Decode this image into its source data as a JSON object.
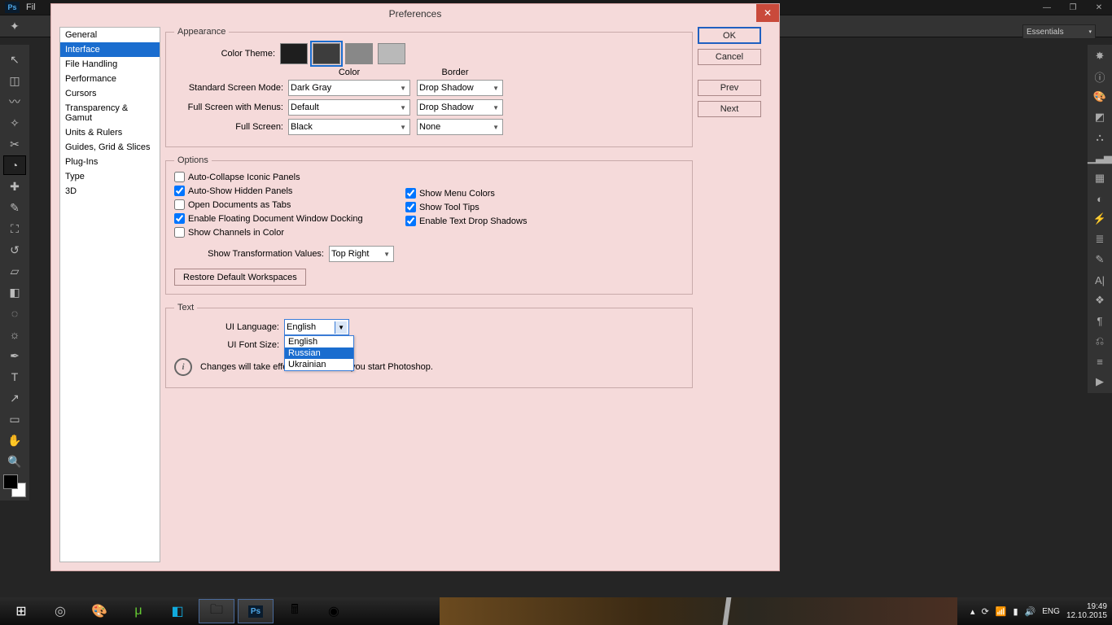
{
  "app": {
    "logo": "Ps",
    "menu_fragment": "Fil"
  },
  "window_controls": {
    "minimize": "—",
    "maximize": "❐",
    "close": "✕"
  },
  "optionbar": {
    "workspace": "Essentials"
  },
  "dialog": {
    "title": "Preferences",
    "buttons": {
      "ok": "OK",
      "cancel": "Cancel",
      "prev": "Prev",
      "next": "Next"
    },
    "nav": [
      "General",
      "Interface",
      "File Handling",
      "Performance",
      "Cursors",
      "Transparency & Gamut",
      "Units & Rulers",
      "Guides, Grid & Slices",
      "Plug-Ins",
      "Type",
      "3D"
    ],
    "nav_selected": 1,
    "appearance": {
      "legend": "Appearance",
      "color_theme_label": "Color Theme:",
      "swatches": [
        "#1e1e1e",
        "#3d3d3d",
        "#888888",
        "#b9b9b9"
      ],
      "swatch_selected": 1,
      "col_color": "Color",
      "col_border": "Border",
      "rows": {
        "standard": {
          "label": "Standard Screen Mode:",
          "color": "Dark Gray",
          "border": "Drop Shadow"
        },
        "menus": {
          "label": "Full Screen with Menus:",
          "color": "Default",
          "border": "Drop Shadow"
        },
        "full": {
          "label": "Full Screen:",
          "color": "Black",
          "border": "None"
        }
      }
    },
    "options": {
      "legend": "Options",
      "auto_collapse": "Auto-Collapse Iconic Panels",
      "auto_show": "Auto-Show Hidden Panels",
      "open_tabs": "Open Documents as Tabs",
      "floating": "Enable Floating Document Window Docking",
      "channels": "Show Channels in Color",
      "menu_colors": "Show Menu Colors",
      "tooltips": "Show Tool Tips",
      "drop_shadows": "Enable Text Drop Shadows",
      "transform_label": "Show Transformation Values:",
      "transform_value": "Top Right",
      "restore_btn": "Restore Default Workspaces"
    },
    "text": {
      "legend": "Text",
      "lang_label": "UI Language:",
      "lang_value": "English",
      "lang_options": [
        "English",
        "Russian",
        "Ukrainian"
      ],
      "lang_hl": 1,
      "font_label": "UI Font Size:",
      "note": "Changes will take effect the next time you start Photoshop."
    }
  },
  "taskbar": {
    "lang": "ENG",
    "time": "19:49",
    "date": "12.10.2015"
  }
}
